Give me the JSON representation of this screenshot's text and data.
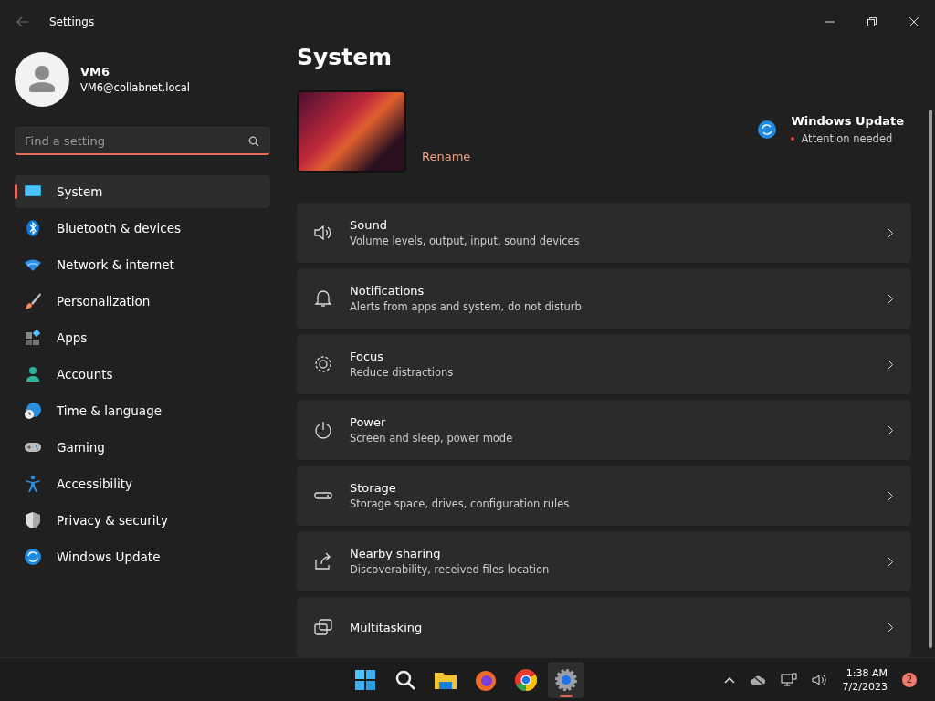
{
  "window": {
    "title": "Settings"
  },
  "account": {
    "name": "VM6",
    "email": "VM6@collabnet.local"
  },
  "search": {
    "placeholder": "Find a setting"
  },
  "sidebar": {
    "items": [
      {
        "label": "System",
        "selected": true
      },
      {
        "label": "Bluetooth & devices",
        "selected": false
      },
      {
        "label": "Network & internet",
        "selected": false
      },
      {
        "label": "Personalization",
        "selected": false
      },
      {
        "label": "Apps",
        "selected": false
      },
      {
        "label": "Accounts",
        "selected": false
      },
      {
        "label": "Time & language",
        "selected": false
      },
      {
        "label": "Gaming",
        "selected": false
      },
      {
        "label": "Accessibility",
        "selected": false
      },
      {
        "label": "Privacy & security",
        "selected": false
      },
      {
        "label": "Windows Update",
        "selected": false
      }
    ]
  },
  "page": {
    "title": "System",
    "rename": "Rename",
    "update": {
      "title": "Windows Update",
      "status": "Attention needed"
    }
  },
  "cards": [
    {
      "title": "Sound",
      "subtitle": "Volume levels, output, input, sound devices"
    },
    {
      "title": "Notifications",
      "subtitle": "Alerts from apps and system, do not disturb"
    },
    {
      "title": "Focus",
      "subtitle": "Reduce distractions"
    },
    {
      "title": "Power",
      "subtitle": "Screen and sleep, power mode"
    },
    {
      "title": "Storage",
      "subtitle": "Storage space, drives, configuration rules"
    },
    {
      "title": "Nearby sharing",
      "subtitle": "Discoverability, received files location"
    },
    {
      "title": "Multitasking"
    }
  ],
  "taskbar": {
    "apps": [
      {
        "selected": false
      },
      {
        "selected": false
      },
      {
        "selected": false
      },
      {
        "selected": false
      },
      {
        "selected": false
      },
      {
        "selected": true
      }
    ],
    "time": "1:38 AM",
    "date": "7/2/2023",
    "badge": "2"
  }
}
